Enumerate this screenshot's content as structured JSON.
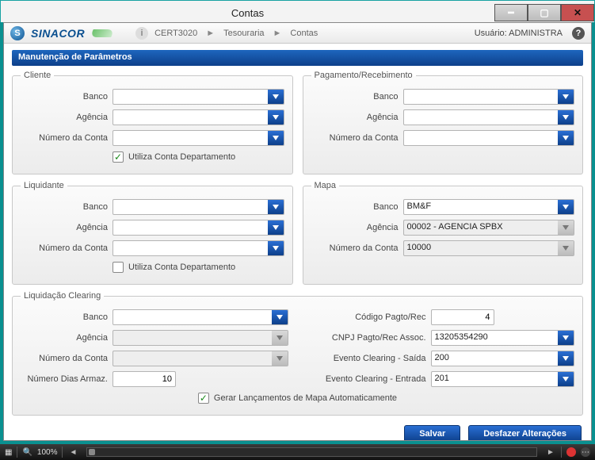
{
  "window": {
    "title": "Contas"
  },
  "topbar": {
    "brand": "SINACOR",
    "logo_letter": "S",
    "breadcrumb": [
      "CERT3020",
      "Tesouraria",
      "Contas"
    ],
    "user_prefix": "Usuário: ",
    "user": "ADMINISTRA"
  },
  "section_title": "Manutenção de Parâmetros",
  "labels": {
    "banco": "Banco",
    "agencia": "Agência",
    "numero_conta": "Número da Conta",
    "utiliza_depto": "Utiliza Conta Departamento",
    "codigo_pagto": "Código Pagto/Rec",
    "cnpj_pagto": "CNPJ Pagto/Rec Assoc.",
    "evento_saida": "Evento Clearing - Saída",
    "evento_entrada": "Evento Clearing - Entrada",
    "dias_armaz": "Número Dias Armaz.",
    "gerar_auto": "Gerar Lançamentos de Mapa Automaticamente"
  },
  "groups": {
    "cliente": {
      "legend": "Cliente",
      "banco": "",
      "agencia": "",
      "numero_conta": "",
      "utiliza_depto_checked": true
    },
    "pagamento": {
      "legend": "Pagamento/Recebimento",
      "banco": "",
      "agencia": "",
      "numero_conta": ""
    },
    "liquidante": {
      "legend": "Liquidante",
      "banco": "",
      "agencia": "",
      "numero_conta": "",
      "utiliza_depto_checked": false
    },
    "mapa": {
      "legend": "Mapa",
      "banco": "BM&F",
      "agencia": "00002 - AGENCIA SPBX",
      "numero_conta": "10000"
    },
    "clearing": {
      "legend": "Liquidação Clearing",
      "banco": "",
      "agencia": "",
      "numero_conta": "",
      "dias_armaz": "10",
      "codigo_pagto": "4",
      "cnpj_pagto": "13205354290",
      "evento_saida": "200",
      "evento_entrada": "201",
      "gerar_auto_checked": true
    }
  },
  "buttons": {
    "save": "Salvar",
    "undo": "Desfazer Alterações"
  },
  "statusbar": {
    "zoom": "100%"
  }
}
